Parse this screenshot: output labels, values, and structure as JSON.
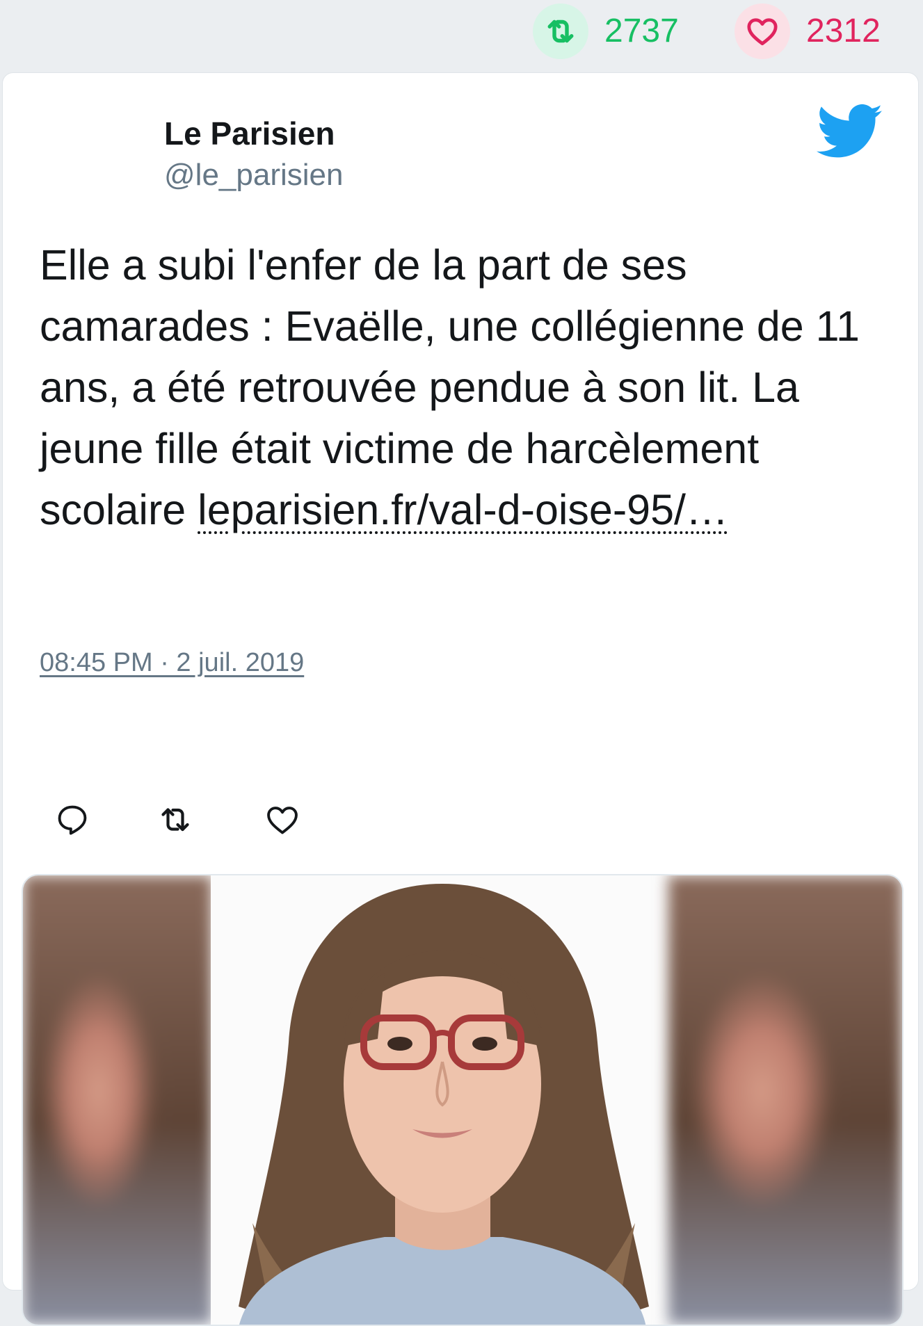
{
  "stats": {
    "retweets": "2737",
    "likes": "2312"
  },
  "tweet": {
    "author_name": "Le Parisien",
    "author_handle": "@le_parisien",
    "text_before_link": "Elle a subi l'enfer de la part de ses camarades : Evaëlle, une collégienne de 11 ans, a été retrouvée pendue à son lit. La jeune fille était victime de harcèlement scolaire ",
    "link_text": "leparisien.fr/val-d-oise-95/…",
    "timestamp": "08:45 PM · 2 juil. 2019"
  },
  "icons": {
    "retweet_stat": "retweet-icon",
    "like_stat": "heart-icon",
    "logo": "twitter-bird-icon",
    "reply_action": "reply-icon",
    "retweet_action": "retweet-icon",
    "like_action": "heart-icon"
  },
  "colors": {
    "retweet": "#17bf63",
    "like": "#e0245e",
    "twitter_blue": "#1da1f2",
    "secondary_text": "#657786"
  }
}
